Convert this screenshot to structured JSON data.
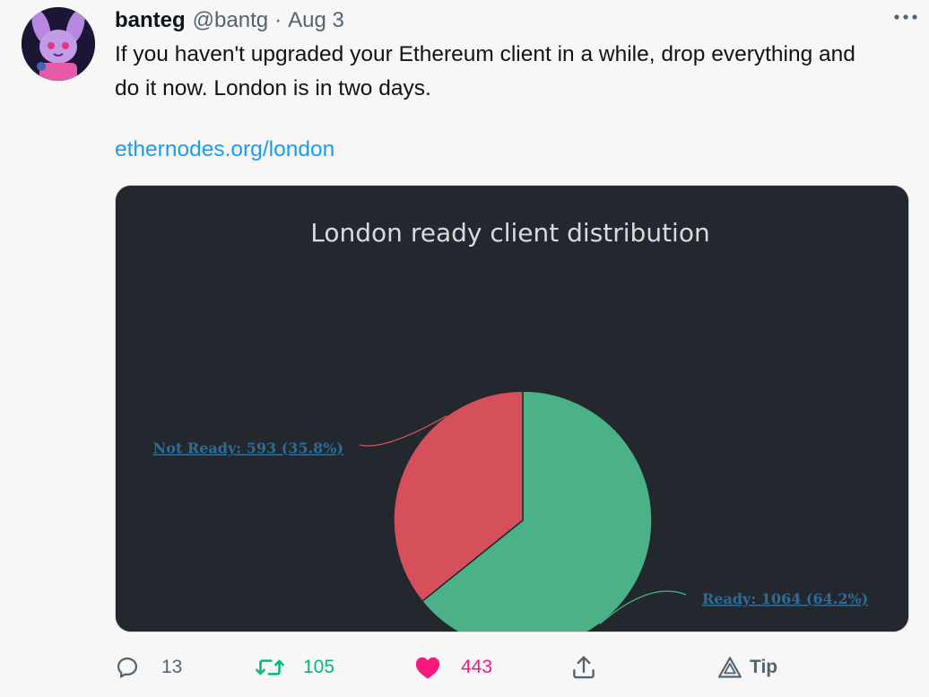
{
  "tweet": {
    "author_name": "banteg",
    "author_handle": "@bantg",
    "separator": "·",
    "date": "Aug 3",
    "text": "If you haven't upgraded your Ethereum client in a while, drop everything and\ndo it now. London is in two days.",
    "link_text": "ethernodes.org/london"
  },
  "icons": {
    "more": "more-horizontal-icon",
    "reply": "reply-bubble-icon",
    "retweet": "retweet-icon",
    "like": "heart-icon",
    "share": "share-upload-icon",
    "tip": "tip-icon"
  },
  "actions": {
    "reply_count": "13",
    "retweet_count": "105",
    "like_count": "443",
    "tip_label": "Tip"
  },
  "colors": {
    "link": "#1d9bf0",
    "retweet_active": "#00ba7c",
    "like_active": "#f91880",
    "chart_background": "#23272e",
    "ready": "#4ab286",
    "not_ready": "#d6505c",
    "chart_label": "#2c6c97"
  },
  "chart_data": {
    "type": "pie",
    "title": "London ready client distribution",
    "slices": [
      {
        "name": "Ready",
        "value": 1064,
        "percent": 64.2,
        "label": "Ready: 1064 (64.2%)",
        "color": "#4ab286"
      },
      {
        "name": "Not Ready",
        "value": 593,
        "percent": 35.8,
        "label": "Not Ready: 593 (35.8%)",
        "color": "#d6505c"
      }
    ],
    "start_angle_deg": 0,
    "direction": "clockwise"
  }
}
